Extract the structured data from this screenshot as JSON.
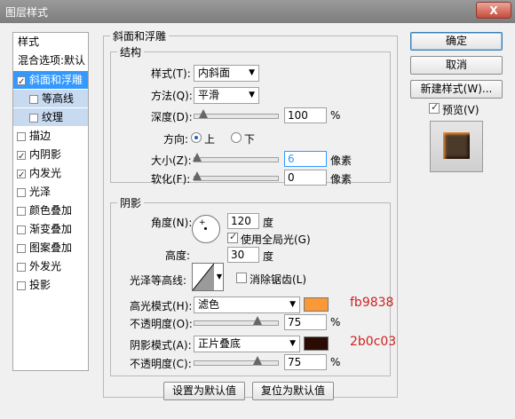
{
  "window": {
    "title": "图层样式",
    "close_label": "X"
  },
  "styles_list": {
    "header1": "样式",
    "header2": "混合选项:默认",
    "items": [
      {
        "label": "斜面和浮雕",
        "checked": true,
        "selected": true
      },
      {
        "label": "等高线",
        "checked": false,
        "sub": true
      },
      {
        "label": "纹理",
        "checked": false,
        "sub": true
      },
      {
        "label": "描边",
        "checked": false
      },
      {
        "label": "内阴影",
        "checked": true
      },
      {
        "label": "内发光",
        "checked": true
      },
      {
        "label": "光泽",
        "checked": false
      },
      {
        "label": "颜色叠加",
        "checked": false
      },
      {
        "label": "渐变叠加",
        "checked": false
      },
      {
        "label": "图案叠加",
        "checked": false
      },
      {
        "label": "外发光",
        "checked": false
      },
      {
        "label": "投影",
        "checked": false
      }
    ]
  },
  "bevel": {
    "group_title": "斜面和浮雕",
    "structure_title": "结构",
    "style_label": "样式(T):",
    "style_value": "内斜面",
    "technique_label": "方法(Q):",
    "technique_value": "平滑",
    "depth_label": "深度(D):",
    "depth_value": "100",
    "depth_unit": "%",
    "direction_label": "方向:",
    "dir_up": "上",
    "dir_down": "下",
    "size_label": "大小(Z):",
    "size_value": "6",
    "size_unit": "像素",
    "soften_label": "软化(F):",
    "soften_value": "0",
    "soften_unit": "像素"
  },
  "shading": {
    "title": "阴影",
    "angle_label": "角度(N):",
    "angle_value": "120",
    "angle_unit": "度",
    "global_light_label": "使用全局光(G)",
    "altitude_label": "高度:",
    "altitude_value": "30",
    "altitude_unit": "度",
    "gloss_contour_label": "光泽等高线:",
    "antialias_label": "消除锯齿(L)",
    "highlight_mode_label": "高光模式(H):",
    "highlight_mode_value": "滤色",
    "highlight_color": "#fb9838",
    "highlight_annot": "fb9838",
    "highlight_opacity_label": "不透明度(O):",
    "highlight_opacity_value": "75",
    "opacity_unit": "%",
    "shadow_mode_label": "阴影模式(A):",
    "shadow_mode_value": "正片叠底",
    "shadow_color": "#2b0c03",
    "shadow_annot": "2b0c03",
    "shadow_opacity_label": "不透明度(C):",
    "shadow_opacity_value": "75"
  },
  "buttons": {
    "ok": "确定",
    "cancel": "取消",
    "new_style": "新建样式(W)...",
    "preview": "预览(V)",
    "make_default": "设置为默认值",
    "reset_default": "复位为默认值"
  }
}
